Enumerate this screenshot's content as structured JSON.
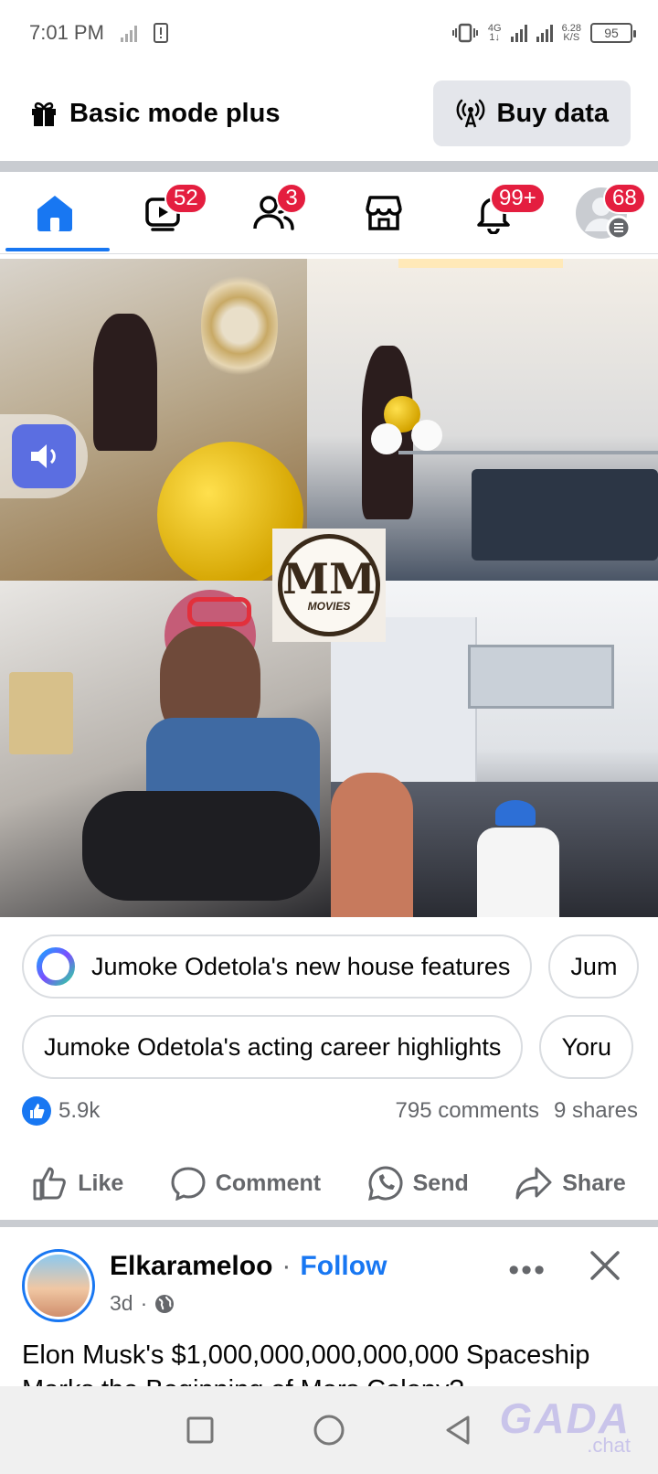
{
  "status_bar": {
    "time": "7:01 PM",
    "network_type": "4G",
    "net_speed_value": "6.28",
    "net_speed_unit": "K/S",
    "battery": "95"
  },
  "top_bar": {
    "basic_mode_label": "Basic mode plus",
    "buy_data_label": "Buy data"
  },
  "tabs": [
    {
      "name": "home",
      "icon": "home-icon",
      "badge": ""
    },
    {
      "name": "video",
      "icon": "video-icon",
      "badge": "52"
    },
    {
      "name": "friends",
      "icon": "friends-icon",
      "badge": "3"
    },
    {
      "name": "marketplace",
      "icon": "marketplace-icon",
      "badge": ""
    },
    {
      "name": "notifications",
      "icon": "bell-icon",
      "badge": "99+"
    },
    {
      "name": "profile",
      "icon": "profile-menu-icon",
      "badge": "68"
    }
  ],
  "collage": {
    "logo_text": "MOVIES"
  },
  "related_searches": {
    "row1": [
      "Jumoke Odetola's new house features",
      "Jum"
    ],
    "row2": [
      "Jumoke Odetola's acting career highlights",
      "Yoru"
    ]
  },
  "post_stats": {
    "likes": "5.9k",
    "comments": "795 comments",
    "shares": "9 shares"
  },
  "actions": {
    "like": "Like",
    "comment": "Comment",
    "send": "Send",
    "share": "Share"
  },
  "next_post": {
    "author": "Elkarameloo",
    "separator": "·",
    "follow_label": "Follow",
    "time": "3d",
    "text_line1": "Elon Musk's $1,000,000,000,000,000 Spaceship",
    "text_line2": "Marks the Beginning of Mars Colony?"
  },
  "watermark": {
    "brand": "GADA",
    "suffix": ".chat"
  },
  "colors": {
    "accent": "#1877f2",
    "badge": "#e41e3f",
    "divider": "#c9ccd1"
  }
}
